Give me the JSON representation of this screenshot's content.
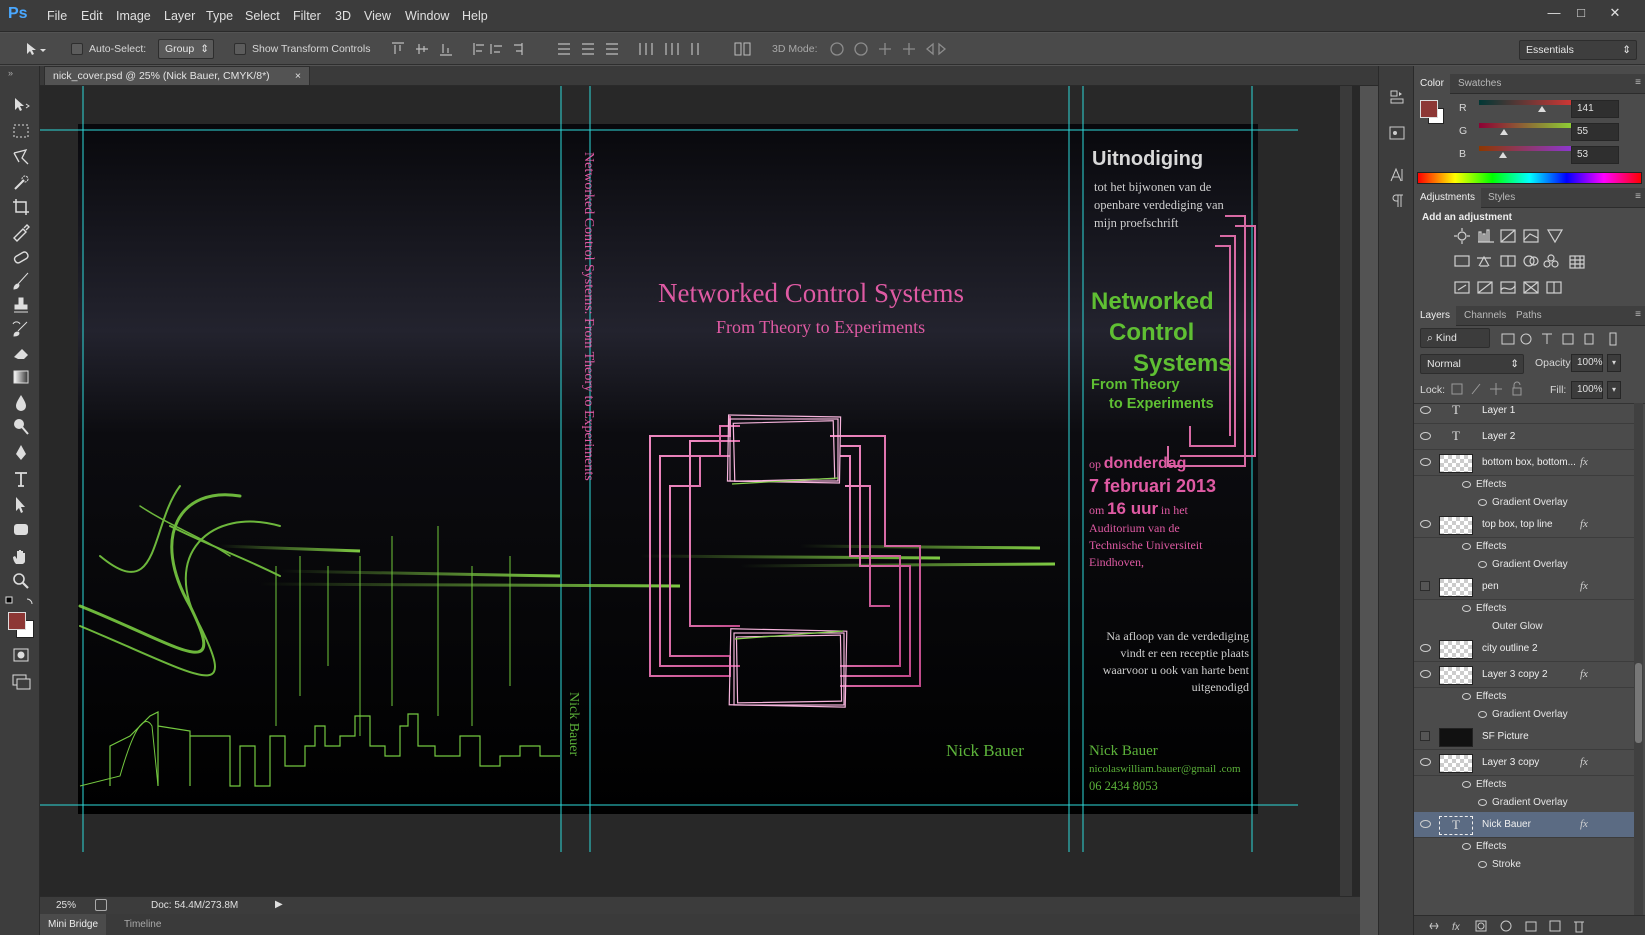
{
  "app": {
    "logo": "Ps"
  },
  "menu": [
    "File",
    "Edit",
    "Image",
    "Layer",
    "Type",
    "Select",
    "Filter",
    "3D",
    "View",
    "Window",
    "Help"
  ],
  "window_controls": {
    "minimize": "—",
    "maximize": "□",
    "close": "✕"
  },
  "options_bar": {
    "auto_select_label": "Auto-Select:",
    "auto_select_value": "Group",
    "show_transform_label": "Show Transform Controls",
    "mode_3d_label": "3D Mode:",
    "workspace": "Essentials"
  },
  "document": {
    "tab_title": "nick_cover.psd @ 25% (Nick Bauer, CMYK/8*)",
    "close_glyph": "×",
    "zoom": "25%",
    "doc_size": "Doc: 54.4M/273.8M",
    "bottom_tabs": [
      "Mini Bridge",
      "Timeline"
    ]
  },
  "cover": {
    "spine_title": "Networked Control Systems: From Theory to Experiments",
    "spine_author": "Nick Bauer",
    "front_title": "Networked Control Systems",
    "front_subtitle": "From Theory to Experiments",
    "front_author": "Nick Bauer",
    "invite_heading": "Uitnodiging",
    "invite_lines": [
      "tot het bijwonen van de",
      "openbare verdediging van",
      "mijn proefschrift"
    ],
    "green_title": [
      "Networked",
      "Control",
      "Systems"
    ],
    "green_subtitle": [
      "From Theory",
      "to Experiments"
    ],
    "when_prefix": "op",
    "when_day": "donderdag",
    "when_date": "7 februari 2013",
    "when_time_prefix": "om",
    "when_time": "16 uur",
    "when_time_suffix": "in het",
    "location_lines": [
      "Auditorium van de",
      "Technische Universiteit",
      "Eindhoven,"
    ],
    "reception_lines": [
      "Na afloop van de verdediging",
      "vindt er een receptie plaats",
      "waarvoor u ook van harte bent",
      "uitgenodigd"
    ],
    "contact_name": "Nick Bauer",
    "contact_email": "nicolaswilliam.bauer@gmail .com",
    "contact_phone": "06 2434 8053"
  },
  "color_panel": {
    "tabs": [
      "Color",
      "Swatches"
    ],
    "fg_color": "#8d3735",
    "r_label": "R",
    "g_label": "G",
    "b_label": "B",
    "r": "141",
    "g": "55",
    "b": "53",
    "r_value": 141,
    "g_value": 55,
    "b_value": 53
  },
  "adjustments_panel": {
    "tabs": [
      "Adjustments",
      "Styles"
    ],
    "heading": "Add an adjustment"
  },
  "layers_panel": {
    "tabs": [
      "Layers",
      "Channels",
      "Paths"
    ],
    "filter_kind": "Kind",
    "blend_mode": "Normal",
    "opacity_label": "Opacity:",
    "opacity": "100%",
    "lock_label": "Lock:",
    "fill_label": "Fill:",
    "fill": "100%",
    "rows": [
      {
        "kind": "layer",
        "name": "Layer 1",
        "type": "text",
        "visible": true,
        "fx": ""
      },
      {
        "kind": "layer",
        "name": "Layer 2",
        "type": "text",
        "visible": true,
        "fx": ""
      },
      {
        "kind": "layer",
        "name": "bottom box, bottom...",
        "type": "pixel",
        "visible": true,
        "fx": "fx"
      },
      {
        "kind": "effects",
        "name": "Effects"
      },
      {
        "kind": "effect",
        "name": "Gradient Overlay"
      },
      {
        "kind": "layer",
        "name": "top box, top line",
        "type": "pixel",
        "visible": true,
        "fx": "fx"
      },
      {
        "kind": "effects",
        "name": "Effects"
      },
      {
        "kind": "effect",
        "name": "Gradient Overlay"
      },
      {
        "kind": "layer",
        "name": "pen",
        "type": "pixel",
        "visible": false,
        "fx": "fx"
      },
      {
        "kind": "effects",
        "name": "Effects"
      },
      {
        "kind": "effect",
        "name": "Outer Glow",
        "hidden": true
      },
      {
        "kind": "layer",
        "name": "city outline 2",
        "type": "pixel",
        "visible": true,
        "fx": ""
      },
      {
        "kind": "layer",
        "name": "Layer 3 copy 2",
        "type": "pixel",
        "visible": true,
        "fx": "fx"
      },
      {
        "kind": "effects",
        "name": "Effects"
      },
      {
        "kind": "effect",
        "name": "Gradient Overlay"
      },
      {
        "kind": "layer",
        "name": "SF Picture",
        "type": "photo",
        "visible": false,
        "fx": ""
      },
      {
        "kind": "layer",
        "name": "Layer 3 copy",
        "type": "pixel",
        "visible": true,
        "fx": "fx"
      },
      {
        "kind": "effects",
        "name": "Effects"
      },
      {
        "kind": "effect",
        "name": "Gradient Overlay"
      },
      {
        "kind": "layer",
        "name": "Nick Bauer",
        "type": "text",
        "visible": true,
        "fx": "fx",
        "selected": true
      },
      {
        "kind": "effects",
        "name": "Effects"
      },
      {
        "kind": "effect",
        "name": "Stroke"
      }
    ]
  }
}
